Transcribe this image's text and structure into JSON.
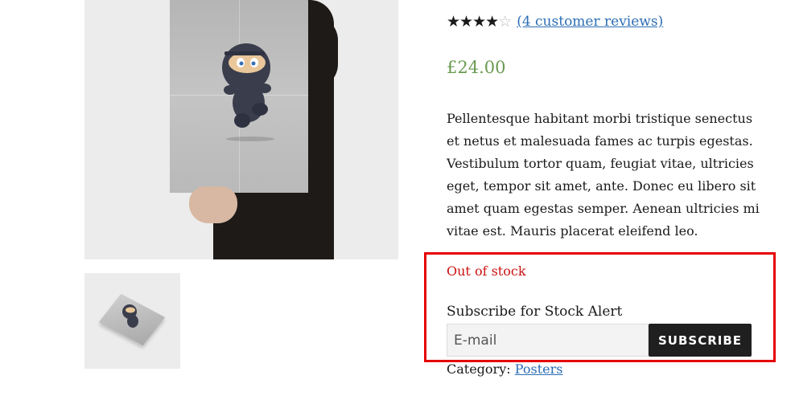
{
  "product": {
    "rating": {
      "value": 4,
      "max": 5,
      "filled_stars": "★★★★",
      "empty_stars": "☆",
      "reviews_link": "(4 customer reviews)"
    },
    "price": "£24.00",
    "description": "Pellentesque habitant morbi tristique senectus et netus et malesuada fames ac turpis egestas. Vestibulum tortor quam, feugiat vitae, ultricies eget, tempor sit amet, ante. Donec eu libero sit amet quam egestas semper. Aenean ultricies mi vitae est. Mauris placerat eleifend leo.",
    "stock_status": "Out of stock",
    "stock_alert": {
      "title": "Subscribe for Stock Alert",
      "email_placeholder": "E-mail",
      "email_value": "",
      "button_label": "SUBSCRIBE"
    },
    "category": {
      "label": "Category:",
      "value": "Posters"
    }
  },
  "colors": {
    "price": "#6a9a52",
    "stock": "#cc1111",
    "link": "#2c6eb5",
    "button_bg": "#1f1f1f",
    "highlight_border": "#e60000"
  },
  "icons": {
    "main_image": "ninja-poster-image",
    "thumbnail": "ninja-poster-thumbnail"
  }
}
